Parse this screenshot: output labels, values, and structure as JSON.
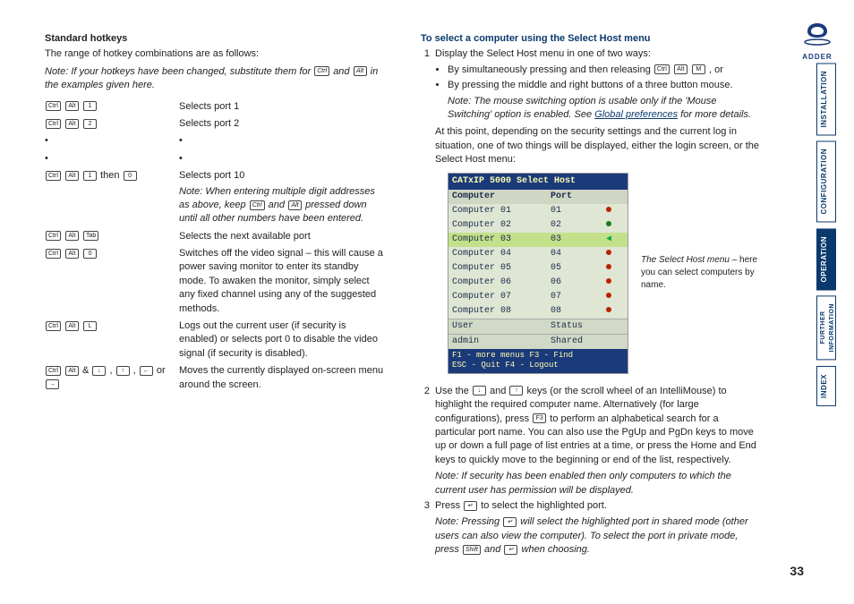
{
  "leftColumn": {
    "title": "Standard hotkeys",
    "intro": "The range of hotkey combinations are as follows:",
    "introNote_pre": "Note: If your hotkeys have been changed, substitute them for ",
    "introNote_mid": " and ",
    "introNote_post": " in the examples given here.",
    "rows": {
      "r1_desc": "Selects port 1",
      "r2_desc": "Selects port 2",
      "r3_joiner": " then ",
      "r3_desc": "Selects port 10",
      "r3_note": "Note: When entering multiple digit addresses as above, keep ",
      "r3_note_mid": " and ",
      "r3_note_post": " pressed down until all other numbers have been entered.",
      "r4_desc": "Selects the next available port",
      "r5_desc": "Switches off the video signal – this will cause a power saving monitor to enter its standby mode. To awaken the monitor, simply select any fixed channel using any of the suggested methods.",
      "r6_desc": "Logs out the current user (if security is enabled) or selects port 0 to disable the video signal (if security is disabled).",
      "r7_joiner1": " & ",
      "r7_joiner2": ", ",
      "r7_joiner3": ", ",
      "r7_joiner4": " or ",
      "r7_desc": "Moves the currently displayed on-screen menu around the screen."
    },
    "keys": {
      "ctrl": "Ctrl",
      "alt": "Alt",
      "k1": "1",
      "k2": "2",
      "k0": "0",
      "tab": "Tab",
      "L": "L",
      "up": "↑",
      "down": "↓",
      "left": "←",
      "right": "→"
    }
  },
  "rightColumn": {
    "title": "To select a computer using the Select Host menu",
    "step1": "Display the Select Host menu in one of two ways:",
    "bullet1_pre": "By simultaneously pressing and then releasing ",
    "bullet1_post": ", or",
    "bullet2": "By pressing the middle and right buttons of a three button mouse.",
    "bulletNote_pre": "Note: The mouse switching option is usable only if the 'Mouse Switching' option is enabled. See ",
    "bulletNote_link": "Global preferences",
    "bulletNote_post": " for more details.",
    "afterBullets": "At this point, depending on the security settings and the current log in situation, one of two things will be displayed, either the login screen, or the Select Host menu:",
    "menuCaption_pre": "The Select Host menu",
    "menuCaption_post": " – here you can select computers by name.",
    "step2_pre": "Use the ",
    "step2_mid": " and ",
    "step2_post": " keys (or the scroll wheel of an IntelliMouse) to highlight the required computer name. Alternatively (for large configurations), press ",
    "step2_after": " to perform an alphabetical search for a particular port name. You can also use the PgUp and PgDn keys to move up or down a full page of list entries at a time, or press the Home and End keys to quickly move to the beginning or end of the list, respectively.",
    "step2_note": "Note: If security has been enabled then only computers to which the current user has permission will be displayed.",
    "step3_pre": "Press ",
    "step3_post": " to select the highlighted port.",
    "step3_note_pre": "Note: Pressing ",
    "step3_note_mid": " will select the highlighted port in shared mode (other users can also view the computer). To select the port in private mode, press ",
    "step3_note_join": " and ",
    "step3_note_post": " when choosing.",
    "keys": {
      "ctrl": "Ctrl",
      "alt": "Alt",
      "M": "M",
      "up": "↑",
      "down": "↓",
      "F3": "F3",
      "enter": "↵",
      "shift": "Shift"
    }
  },
  "selectHostMenu": {
    "title": "CATxIP 5000 Select Host",
    "colComputer": "Computer",
    "colPort": "Port",
    "rows": [
      {
        "name": "Computer 01",
        "port": "01",
        "dot": "red"
      },
      {
        "name": "Computer 02",
        "port": "02",
        "dot": "green"
      },
      {
        "name": "Computer 03",
        "port": "03",
        "dot": "red",
        "selected": true,
        "tri": "◀"
      },
      {
        "name": "Computer 04",
        "port": "04",
        "dot": "red"
      },
      {
        "name": "Computer 05",
        "port": "05",
        "dot": "red"
      },
      {
        "name": "Computer 06",
        "port": "06",
        "dot": "red"
      },
      {
        "name": "Computer 07",
        "port": "07",
        "dot": "red"
      },
      {
        "name": "Computer 08",
        "port": "08",
        "dot": "red"
      }
    ],
    "userLabel": "User",
    "statusLabel": "Status",
    "userValue": "admin",
    "statusValue": "Shared",
    "foot1": "F1 - more menus   F3 - Find",
    "foot2": "ESC - Quit        F4 - Logout"
  },
  "sideTabs": {
    "t1": "INSTALLATION",
    "t2": "CONFIGURATION",
    "t3": "OPERATION",
    "t4a": "FURTHER",
    "t4b": "INFORMATION",
    "t5": "INDEX"
  },
  "brand": "ADDER",
  "pageNumber": "33"
}
